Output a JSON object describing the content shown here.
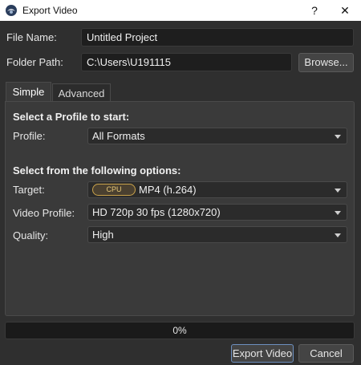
{
  "window": {
    "title": "Export Video",
    "help_glyph": "?",
    "close_glyph": "✕"
  },
  "file_name": {
    "label": "File Name:",
    "value": "Untitled Project"
  },
  "folder_path": {
    "label": "Folder Path:",
    "value": "C:\\Users\\U191115",
    "browse_label": "Browse..."
  },
  "tabs": [
    {
      "label": "Simple",
      "active": true
    },
    {
      "label": "Advanced",
      "active": false
    }
  ],
  "simple": {
    "profile_section_title": "Select a Profile to start:",
    "profile": {
      "label": "Profile:",
      "value": "All Formats"
    },
    "options_section_title": "Select from the following options:",
    "target": {
      "label": "Target:",
      "badge": "CPU",
      "value": "MP4 (h.264)"
    },
    "video_profile": {
      "label": "Video Profile:",
      "value": "HD 720p 30 fps (1280x720)"
    },
    "quality": {
      "label": "Quality:",
      "value": "High"
    }
  },
  "progress": {
    "text": "0%",
    "fraction": 0
  },
  "buttons": {
    "export": "Export Video",
    "cancel": "Cancel"
  },
  "colors": {
    "background": "#2f2f2f",
    "panel": "#3a3a3a",
    "badge": "#c9a24a"
  },
  "icons": {
    "app": "openshot-logo-icon",
    "dropdown": "chevron-down-icon"
  }
}
